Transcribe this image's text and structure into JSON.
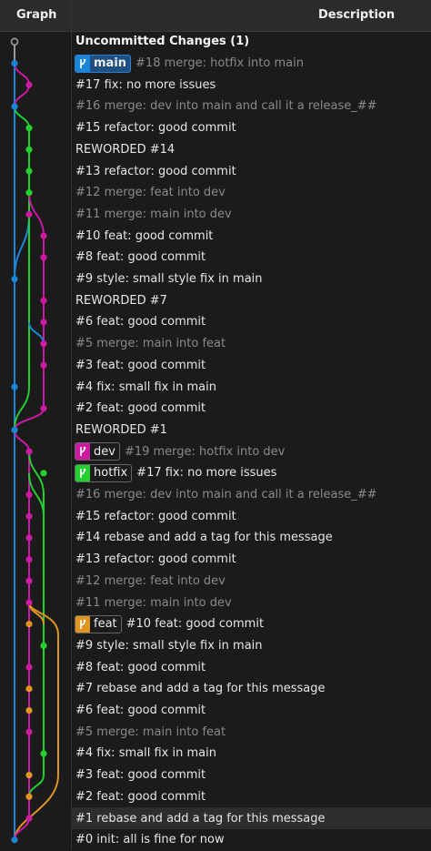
{
  "header": {
    "graph_label": "Graph",
    "description_label": "Description"
  },
  "colors": {
    "blue": "#1a86d8",
    "magenta": "#cc1aa2",
    "green": "#22d030",
    "orange": "#e09520",
    "gray": "#9a9a9a"
  },
  "rows": [
    {
      "text": "Uncommitted Changes (1)",
      "style": "bold"
    },
    {
      "text": "#18 merge: hotfix into main",
      "style": "dim",
      "tag": {
        "label": "main",
        "color": "#1a86d8",
        "icon": "branch-icon",
        "head": true
      }
    },
    {
      "text": "#17 fix: no more issues",
      "style": "normal"
    },
    {
      "text": "#16 merge: dev into main and call it a release_##",
      "style": "dim"
    },
    {
      "text": "#15 refactor: good commit",
      "style": "normal"
    },
    {
      "text": "REWORDED #14",
      "style": "normal"
    },
    {
      "text": "#13 refactor: good commit",
      "style": "normal"
    },
    {
      "text": "#12 merge: feat into dev",
      "style": "dim"
    },
    {
      "text": "#11 merge: main into dev",
      "style": "dim"
    },
    {
      "text": "#10 feat: good commit",
      "style": "normal"
    },
    {
      "text": "#8 feat: good commit",
      "style": "normal"
    },
    {
      "text": "#9 style: small style fix in main",
      "style": "normal"
    },
    {
      "text": "REWORDED #7",
      "style": "normal"
    },
    {
      "text": "#6 feat: good commit",
      "style": "normal"
    },
    {
      "text": "#5 merge: main into feat",
      "style": "dim"
    },
    {
      "text": "#3 feat: good commit",
      "style": "normal"
    },
    {
      "text": "#4 fix: small fix in main",
      "style": "normal"
    },
    {
      "text": "#2 feat: good commit",
      "style": "normal"
    },
    {
      "text": "REWORDED #1",
      "style": "normal"
    },
    {
      "text": "#19 merge: hotfix into dev",
      "style": "dim",
      "tag": {
        "label": "dev",
        "color": "#cc1aa2",
        "icon": "branch-icon"
      }
    },
    {
      "text": "#17 fix: no more issues",
      "style": "normal",
      "tag": {
        "label": "hotfix",
        "color": "#22d030",
        "icon": "branch-icon"
      }
    },
    {
      "text": "#16 merge: dev into main and call it a release_##",
      "style": "dim"
    },
    {
      "text": "#15 refactor: good commit",
      "style": "normal"
    },
    {
      "text": "#14 rebase and add a tag for this message",
      "style": "normal"
    },
    {
      "text": "#13 refactor: good commit",
      "style": "normal"
    },
    {
      "text": "#12 merge: feat into dev",
      "style": "dim"
    },
    {
      "text": "#11 merge: main into dev",
      "style": "dim"
    },
    {
      "text": "#10 feat: good commit",
      "style": "normal",
      "tag": {
        "label": "feat",
        "color": "#e09520",
        "icon": "branch-icon"
      }
    },
    {
      "text": "#9 style: small style fix in main",
      "style": "normal"
    },
    {
      "text": "#8 feat: good commit",
      "style": "normal"
    },
    {
      "text": "#7 rebase and add a tag for this message",
      "style": "normal"
    },
    {
      "text": "#6 feat: good commit",
      "style": "normal"
    },
    {
      "text": "#5 merge: main into feat",
      "style": "dim"
    },
    {
      "text": "#4 fix: small fix in main",
      "style": "normal"
    },
    {
      "text": "#3 feat: good commit",
      "style": "normal"
    },
    {
      "text": "#2 feat: good commit",
      "style": "normal"
    },
    {
      "text": "#1 rebase and add a tag for this message",
      "style": "selected"
    },
    {
      "text": "#0 init: all is fine for now",
      "style": "normal"
    }
  ]
}
